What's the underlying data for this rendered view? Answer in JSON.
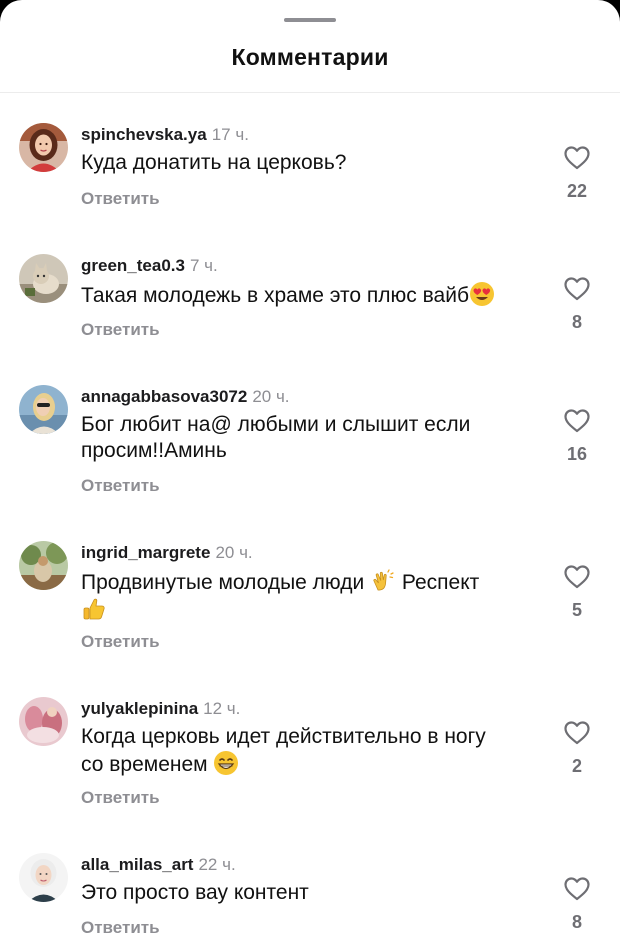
{
  "sheet": {
    "title": "Комментарии"
  },
  "comments": [
    {
      "username": "spinchevska.ya",
      "time": "17 ч.",
      "text": "Куда донатить на церковь?",
      "reply_label": "Ответить",
      "likes": "22",
      "avatar_icon": "profile-photo-woman"
    },
    {
      "username": "green_tea0.3",
      "time": "7 ч.",
      "text": "Такая молодежь в храме это плюс вайб",
      "emoji": "heart-eyes-emoji",
      "reply_label": "Ответить",
      "likes": "8",
      "avatar_icon": "profile-photo-cat"
    },
    {
      "username": "annagabbasova3072",
      "time": "20 ч.",
      "text_lines": [
        "Бог любит на@ любыми и слышит если",
        "просим!!Аминь"
      ],
      "reply_label": "Ответить",
      "likes": "16",
      "avatar_icon": "profile-photo-woman-blonde"
    },
    {
      "username": "ingrid_margrete",
      "time": "20 ч.",
      "text_before_emoji": "Продвинутые молодые люди",
      "emoji_1": "clapping-hands-emoji",
      "text_after_emoji": "Респект",
      "emoji_2": "thumbs-up-emoji",
      "reply_label": "Ответить",
      "likes": "5",
      "avatar_icon": "profile-photo-garden"
    },
    {
      "username": "yulyaklepinina",
      "time": "12 ч.",
      "text_lines": [
        "Когда церковь идет действительно в ногу",
        "со временем"
      ],
      "emoji": "grinning-face-emoji",
      "reply_label": "Ответить",
      "likes": "2",
      "avatar_icon": "profile-photo-pink"
    },
    {
      "username": "alla_milas_art",
      "time": "22 ч.",
      "text": "Это просто вау контент",
      "reply_label": "Ответить",
      "likes": "8",
      "avatar_icon": "profile-photo-woman-light"
    }
  ],
  "colors": {
    "background": "#ffffff",
    "text": "#111111",
    "secondary": "#8e8e93",
    "like_count": "#6e6e73"
  }
}
